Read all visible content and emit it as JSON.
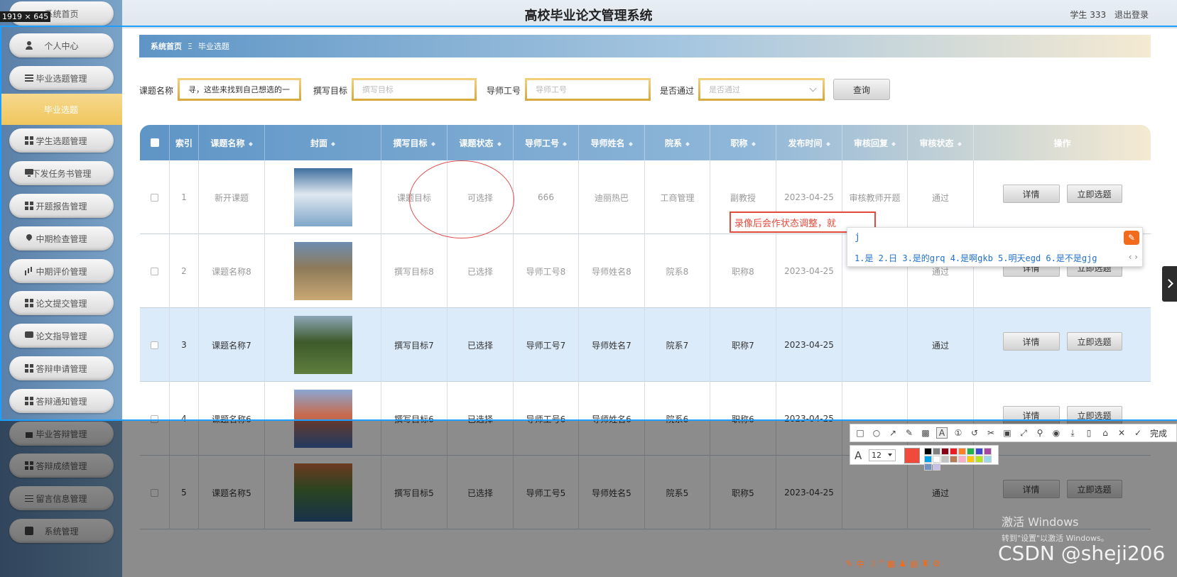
{
  "screen_size_badge": "1919 × 645",
  "header": {
    "title": "高校毕业论文管理系统",
    "user": "学生 333",
    "logout": "退出登录"
  },
  "sidebar": {
    "items": [
      {
        "label": "系统首页",
        "icon": "house-icon"
      },
      {
        "label": "个人中心",
        "icon": "user-icon"
      },
      {
        "label": "毕业选题管理",
        "icon": "list-icon"
      },
      {
        "label": "学生选题管理",
        "icon": "grid-icon"
      },
      {
        "label": "下发任务书管理",
        "icon": "monitor-icon"
      },
      {
        "label": "开题报告管理",
        "icon": "grid-icon"
      },
      {
        "label": "中期检查管理",
        "icon": "pin-icon"
      },
      {
        "label": "中期评价管理",
        "icon": "bar-chart-icon"
      },
      {
        "label": "论文提交管理",
        "icon": "grid-icon"
      },
      {
        "label": "论文指导管理",
        "icon": "chat-icon"
      },
      {
        "label": "答辩申请管理",
        "icon": "grid-icon"
      },
      {
        "label": "答辩通知管理",
        "icon": "grid-icon"
      },
      {
        "label": "毕业答辩管理",
        "icon": "house-icon"
      },
      {
        "label": "答辩成绩管理",
        "icon": "grid-icon"
      },
      {
        "label": "留言信息管理",
        "icon": "sliders-icon"
      },
      {
        "label": "系统管理",
        "icon": "chart-icon"
      }
    ],
    "active_sub": "毕业选题"
  },
  "breadcrumb": {
    "home": "系统首页",
    "separator": "Ξ",
    "current": "毕业选题"
  },
  "search": {
    "title_label": "课题名称",
    "title_value": "寻，这些来找到自己想选的一",
    "goal_label": "撰写目标",
    "goal_placeholder": "撰写目标",
    "tutor_label": "导师工号",
    "tutor_placeholder": "导师工号",
    "pass_label": "是否通过",
    "pass_placeholder": "是否通过",
    "query_button": "查询"
  },
  "table": {
    "headers": [
      "索引",
      "课题名称",
      "封面",
      "撰写目标",
      "课题状态",
      "导师工号",
      "导师姓名",
      "院系",
      "职称",
      "发布时间",
      "审核回复",
      "审核状态",
      "操作"
    ],
    "detail_label": "详情",
    "pick_label": "立即选题",
    "rows": [
      {
        "index": "1",
        "title": "新开课题",
        "goal": "课题目标",
        "status": "可选择",
        "tutor_id": "666",
        "tutor_name": "迪丽热巴",
        "dept": "工商管理",
        "rank": "副教授",
        "date": "2023-04-25",
        "reply": "审核教师开题",
        "audit": "通过"
      },
      {
        "index": "2",
        "title": "课题名称8",
        "goal": "撰写目标8",
        "status": "已选择",
        "tutor_id": "导师工号8",
        "tutor_name": "导师姓名8",
        "dept": "院系8",
        "rank": "职称8",
        "date": "2023-04-25",
        "reply": "",
        "audit": "通过"
      },
      {
        "index": "3",
        "title": "课题名称7",
        "goal": "撰写目标7",
        "status": "已选择",
        "tutor_id": "导师工号7",
        "tutor_name": "导师姓名7",
        "dept": "院系7",
        "rank": "职称7",
        "date": "2023-04-25",
        "reply": "",
        "audit": "通过"
      },
      {
        "index": "4",
        "title": "课题名称6",
        "goal": "撰写目标6",
        "status": "已选择",
        "tutor_id": "导师工号6",
        "tutor_name": "导师姓名6",
        "dept": "院系6",
        "rank": "职称6",
        "date": "2023-04-25",
        "reply": "",
        "audit": ""
      },
      {
        "index": "5",
        "title": "课题名称5",
        "goal": "撰写目标5",
        "status": "已选择",
        "tutor_id": "导师工号5",
        "tutor_name": "导师姓名5",
        "dept": "院系5",
        "rank": "职称5",
        "date": "2023-04-25",
        "reply": "",
        "audit": "通过"
      }
    ]
  },
  "annotation": {
    "text": "录像后会作状态调整，就"
  },
  "ime": {
    "typed": "j",
    "candidates": "1.是  2.日  3.是的grq  4.是啊gkb  5.明天egd  6.是不是gjg",
    "arrows": "‹ ›"
  },
  "screenshot_toolbar": {
    "done_label": "完成",
    "font_size": "12",
    "current_color": "#f04a3a"
  },
  "watermark": {
    "windows_line1": "激活 Windows",
    "windows_line2": "转到\"设置\"以激活 Windows。",
    "csdn": "CSDN @sheji206"
  },
  "colors": {
    "accent_blue": "#5e95c6",
    "accent_gold": "#f0c65e",
    "annotation_red": "#e24a3a"
  }
}
